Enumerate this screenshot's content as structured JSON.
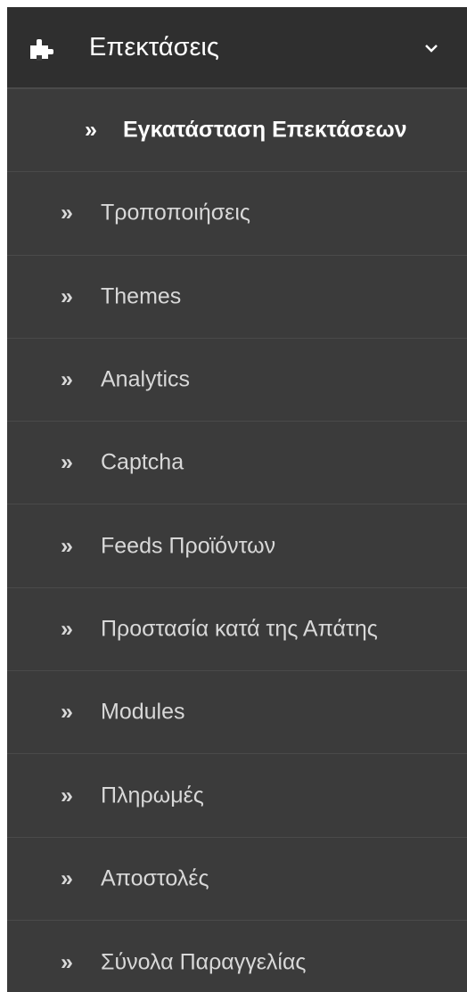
{
  "menu": {
    "header": {
      "icon": "puzzle-piece-icon",
      "label": "Επεκτάσεις",
      "expand_icon": "chevron-down-icon"
    },
    "item_icon": "double-chevron-right-icon",
    "items": [
      {
        "label": "Εγκατάσταση Επεκτάσεων",
        "active": true
      },
      {
        "label": "Τροποποιήσεις"
      },
      {
        "label": "Themes"
      },
      {
        "label": "Analytics"
      },
      {
        "label": "Captcha"
      },
      {
        "label": "Feeds Προϊόντων"
      },
      {
        "label": "Προστασία κατά της Απάτης"
      },
      {
        "label": "Modules"
      },
      {
        "label": "Πληρωμές"
      },
      {
        "label": "Αποστολές"
      },
      {
        "label": "Σύνολα Παραγγελίας"
      }
    ]
  }
}
